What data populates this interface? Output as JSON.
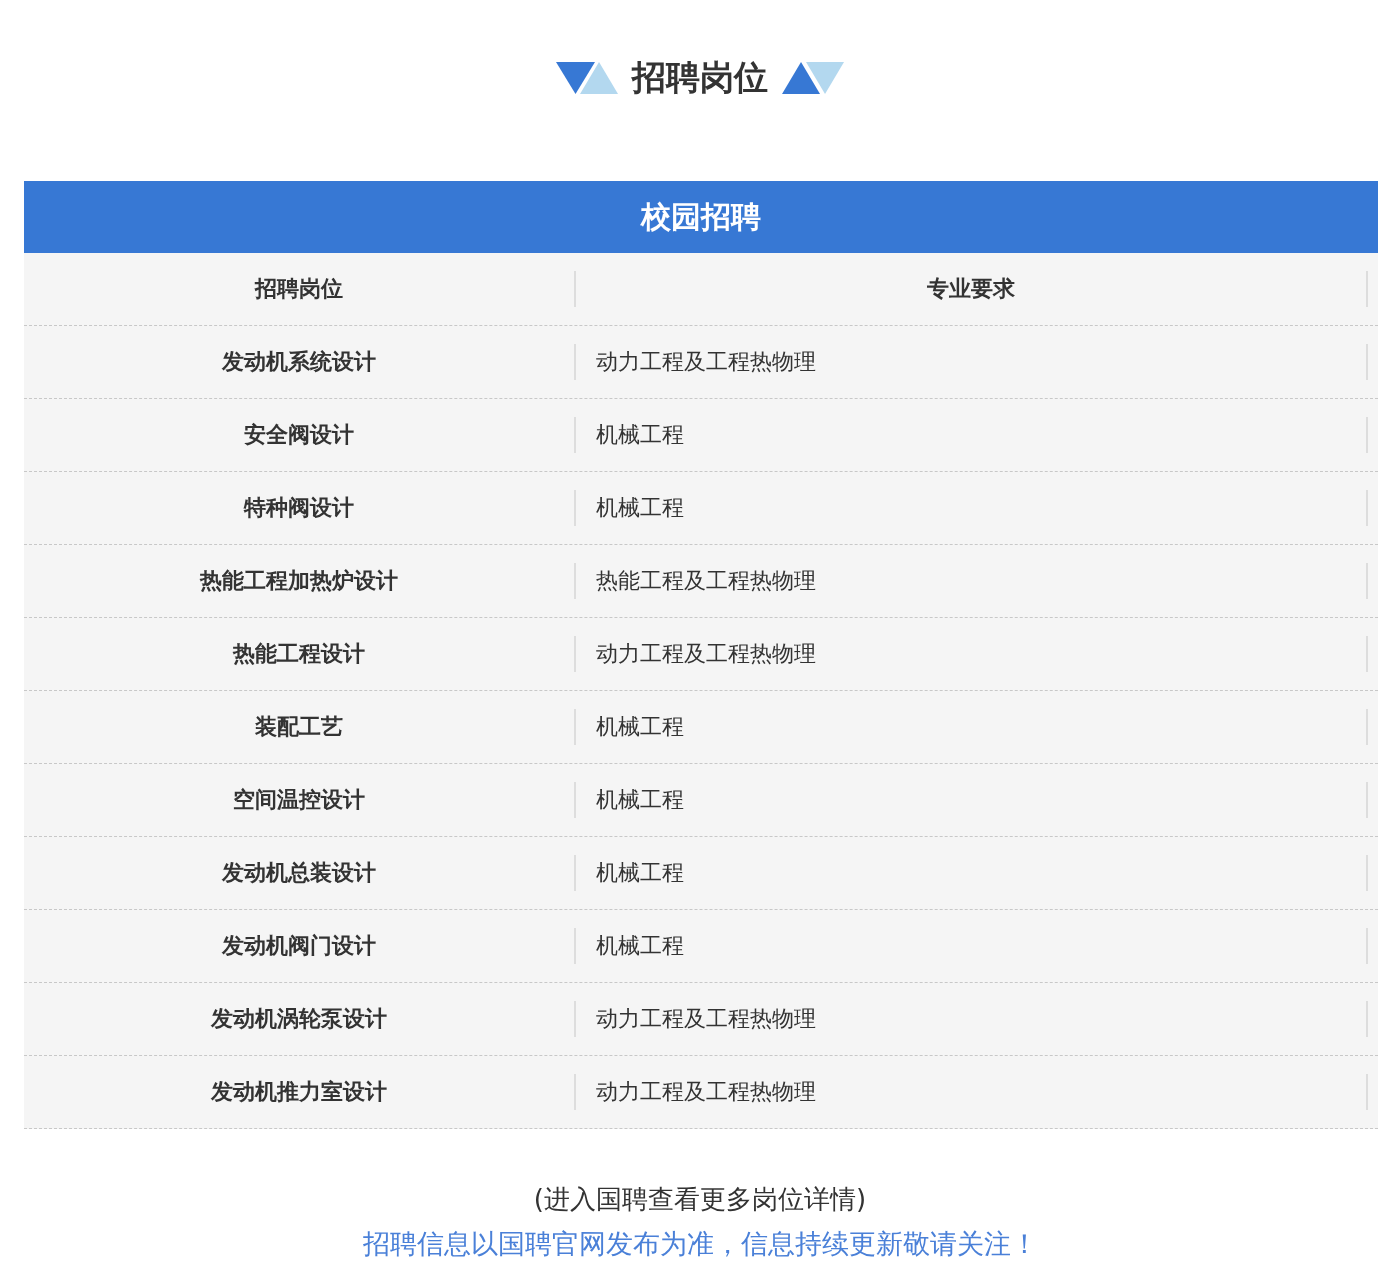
{
  "heading": {
    "title": "招聘岗位"
  },
  "table": {
    "title": "校园招聘",
    "columns": [
      "招聘岗位",
      "专业要求"
    ],
    "rows": [
      {
        "position": "发动机系统设计",
        "major": "动力工程及工程热物理"
      },
      {
        "position": "安全阀设计",
        "major": "机械工程"
      },
      {
        "position": "特种阀设计",
        "major": "机械工程"
      },
      {
        "position": "热能工程加热炉设计",
        "major": "热能工程及工程热物理"
      },
      {
        "position": "热能工程设计",
        "major": "动力工程及工程热物理"
      },
      {
        "position": "装配工艺",
        "major": "机械工程"
      },
      {
        "position": "空间温控设计",
        "major": "机械工程"
      },
      {
        "position": "发动机总装设计",
        "major": "机械工程"
      },
      {
        "position": "发动机阀门设计",
        "major": "机械工程"
      },
      {
        "position": "发动机涡轮泵设计",
        "major": "动力工程及工程热物理"
      },
      {
        "position": "发动机推力室设计",
        "major": "动力工程及工程热物理"
      }
    ]
  },
  "footer": {
    "note": "(进入国聘查看更多岗位详情)",
    "notice": "招聘信息以国聘官网发布为准，信息持续更新敬请关注！"
  }
}
